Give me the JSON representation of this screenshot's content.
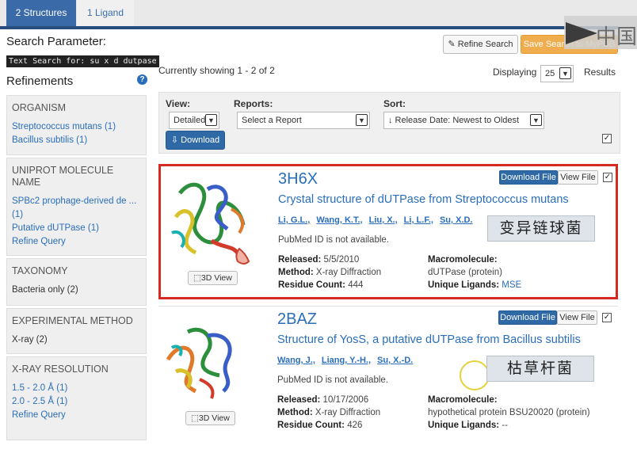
{
  "tabs": {
    "structures": "2 Structures",
    "ligand": "1 Ligand"
  },
  "watermark": "中国",
  "left": {
    "search_title": "Search Parameter:",
    "search_text": "Text Search for: su x d dutpase",
    "refinements": "Refinements",
    "help": "?",
    "organism": {
      "title": "ORGANISM",
      "items": [
        "Streptococcus mutans (1)",
        "Bacillus subtilis (1)"
      ]
    },
    "uniprot": {
      "title": "UNIPROT MOLECULE NAME",
      "items": [
        "SPBc2 prophage-derived de ...",
        "(1)",
        "Putative dUTPase (1)",
        "Refine Query"
      ]
    },
    "taxonomy": {
      "title": "TAXONOMY",
      "items": [
        "Bacteria only (2)"
      ]
    },
    "method": {
      "title": "EXPERIMENTAL METHOD",
      "items": [
        "X-ray (2)"
      ]
    },
    "resolution": {
      "title": "X-RAY RESOLUTION",
      "items": [
        "1.5 - 2.0 Å (1)",
        "2.0 - 2.5 Å (1)",
        "Refine Query"
      ]
    }
  },
  "main": {
    "refine_search": "Refine Search",
    "save_search": "Save Search to MyPDB",
    "showing": "Currently showing 1 - 2 of 2",
    "displaying": "Displaying",
    "per_page": "25",
    "results": "Results",
    "view_label": "View:",
    "view_value": "Detailed",
    "reports_label": "Reports:",
    "reports_value": "Select a Report",
    "sort_label": "Sort:",
    "sort_value": "↓ Release Date: Newest to Oldest",
    "download": "Download",
    "check": "✓"
  },
  "results": [
    {
      "id": "3H6X",
      "title": "Crystal structure of dUTPase from Streptococcus mutans",
      "authors": [
        "Li, G.L.,",
        "Wang, K.T.,",
        "Liu, X.,",
        "Li, L.F.,",
        "Su, X.D."
      ],
      "pubmed": "PubMed ID is not available.",
      "released_label": "Released:",
      "released": "5/5/2010",
      "method_label": "Method:",
      "method": "X-ray Diffraction",
      "residue_label": "Residue Count:",
      "residue": "444",
      "macro_label": "Macromolecule:",
      "macro": "dUTPase (protein)",
      "ligands_label": "Unique Ligands:",
      "ligands": "MSE",
      "view3d": "3D View",
      "download_file": "Download File",
      "view_file": "View File",
      "annotation": "变异链球菌"
    },
    {
      "id": "2BAZ",
      "title": "Structure of YosS, a putative dUTPase from Bacillus subtilis",
      "authors": [
        "Wang, J.,",
        "Liang, Y.-H.,",
        "Su, X.-D."
      ],
      "pubmed": "PubMed ID is not available.",
      "released_label": "Released:",
      "released": "10/17/2006",
      "method_label": "Method:",
      "method": "X-ray Diffraction",
      "residue_label": "Residue Count:",
      "residue": "426",
      "macro_label": "Macromolecule:",
      "macro": "hypothetical protein BSU20020 (protein)",
      "ligands_label": "Unique Ligands:",
      "ligands": "--",
      "view3d": "3D View",
      "download_file": "Download File",
      "view_file": "View File",
      "annotation": "枯草杆菌"
    }
  ],
  "colors": {
    "tab_active": "#3b6aa8",
    "link": "#2a6ebb",
    "highlight": "#d42a20",
    "orange": "#f0ad4e"
  }
}
